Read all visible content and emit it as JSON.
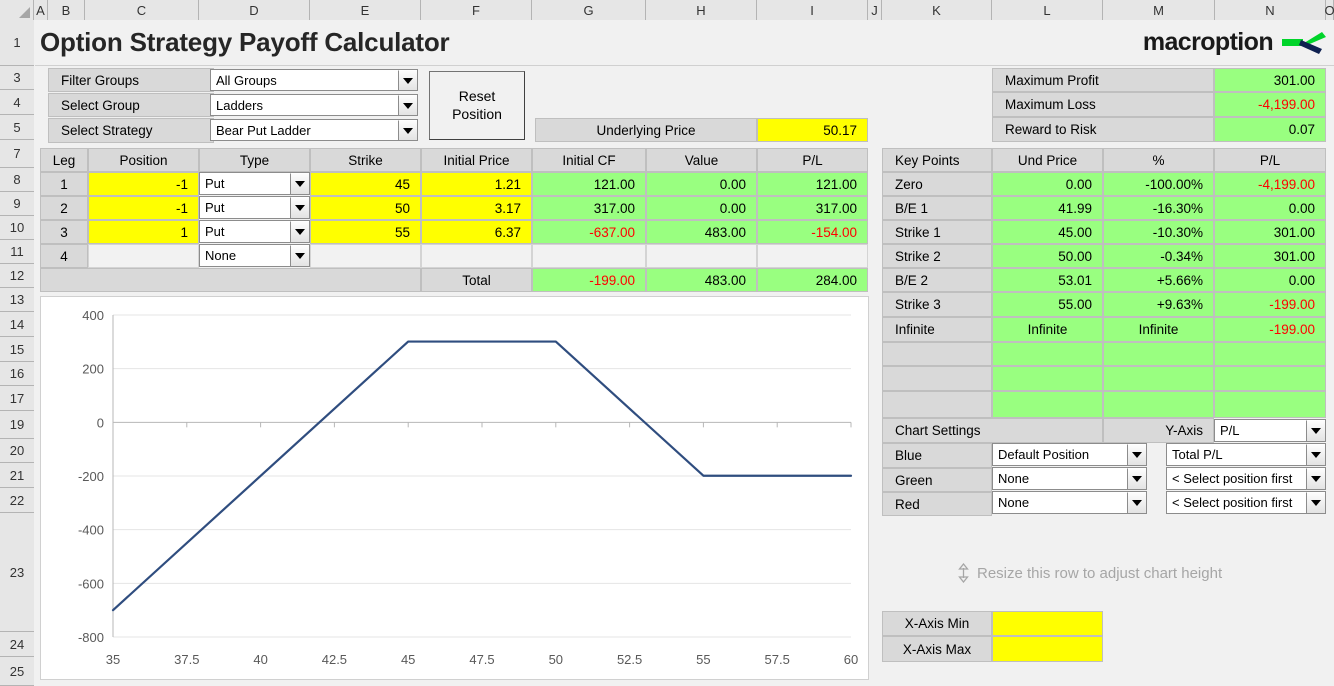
{
  "app": {
    "title": "Option Strategy Payoff Calculator",
    "logo_text": "macroption",
    "column_headers": [
      "A",
      "B",
      "C",
      "D",
      "E",
      "F",
      "G",
      "H",
      "I",
      "J",
      "K",
      "L",
      "M",
      "N",
      "O"
    ],
    "row_headers": [
      "1",
      "3",
      "4",
      "5",
      "7",
      "8",
      "9",
      "10",
      "11",
      "12",
      "13",
      "14",
      "15",
      "16",
      "17",
      "19",
      "20",
      "21",
      "22",
      "23",
      "24",
      "25"
    ]
  },
  "selectors": {
    "filter_groups_label": "Filter Groups",
    "filter_groups_value": "All Groups",
    "select_group_label": "Select Group",
    "select_group_value": "Ladders",
    "select_strategy_label": "Select Strategy",
    "select_strategy_value": "Bear Put Ladder"
  },
  "reset_button": {
    "line1": "Reset",
    "line2": "Position"
  },
  "underlying": {
    "label": "Underlying Price",
    "value": "50.17"
  },
  "summary": {
    "rows": [
      {
        "label": "Maximum Profit",
        "value": "301.00",
        "negative": false
      },
      {
        "label": "Maximum Loss",
        "value": "-4,199.00",
        "negative": true
      },
      {
        "label": "Reward to Risk",
        "value": "0.07",
        "negative": false
      }
    ]
  },
  "legs_table": {
    "headers": [
      "Leg",
      "Position",
      "Type",
      "Strike",
      "Initial Price",
      "Initial CF",
      "Value",
      "P/L"
    ],
    "rows": [
      {
        "leg": "1",
        "position": "-1",
        "type": "Put",
        "strike": "45",
        "initial_price": "1.21",
        "initial_cf": "121.00",
        "cf_negative": false,
        "value": "0.00",
        "pl": "121.00",
        "pl_negative": false,
        "active": true
      },
      {
        "leg": "2",
        "position": "-1",
        "type": "Put",
        "strike": "50",
        "initial_price": "3.17",
        "initial_cf": "317.00",
        "cf_negative": false,
        "value": "0.00",
        "pl": "317.00",
        "pl_negative": false,
        "active": true
      },
      {
        "leg": "3",
        "position": "1",
        "type": "Put",
        "strike": "55",
        "initial_price": "6.37",
        "initial_cf": "-637.00",
        "cf_negative": true,
        "value": "483.00",
        "pl": "-154.00",
        "pl_negative": true,
        "active": true
      },
      {
        "leg": "4",
        "position": "",
        "type": "None",
        "strike": "",
        "initial_price": "",
        "initial_cf": "",
        "cf_negative": false,
        "value": "",
        "pl": "",
        "pl_negative": false,
        "active": false
      }
    ],
    "total": {
      "label": "Total",
      "initial_cf": "-199.00",
      "cf_negative": true,
      "value": "483.00",
      "pl": "284.00",
      "pl_negative": false
    }
  },
  "key_points": {
    "headers": [
      "Key Points",
      "Und Price",
      "%",
      "P/L"
    ],
    "rows": [
      {
        "name": "Zero",
        "und_price": "0.00",
        "pct": "-100.00%",
        "pl": "-4,199.00",
        "pl_negative": true
      },
      {
        "name": "B/E 1",
        "und_price": "41.99",
        "pct": "-16.30%",
        "pl": "0.00",
        "pl_negative": false
      },
      {
        "name": "Strike 1",
        "und_price": "45.00",
        "pct": "-10.30%",
        "pl": "301.00",
        "pl_negative": false
      },
      {
        "name": "Strike 2",
        "und_price": "50.00",
        "pct": "-0.34%",
        "pl": "301.00",
        "pl_negative": false
      },
      {
        "name": "B/E 2",
        "und_price": "53.01",
        "pct": "+5.66%",
        "pl": "0.00",
        "pl_negative": false
      },
      {
        "name": "Strike 3",
        "und_price": "55.00",
        "pct": "+9.63%",
        "pl": "-199.00",
        "pl_negative": true
      },
      {
        "name": "Infinite",
        "und_price": "Infinite",
        "pct": "Infinite",
        "pl": "-199.00",
        "pl_negative": true
      }
    ],
    "empty_rows": 3
  },
  "chart_settings": {
    "title": "Chart Settings",
    "y_axis_label": "Y-Axis",
    "y_axis_value": "P/L",
    "series": [
      {
        "color_label": "Blue",
        "position": "Default Position",
        "metric": "Total P/L"
      },
      {
        "color_label": "Green",
        "position": "None",
        "metric": "< Select position first"
      },
      {
        "color_label": "Red",
        "position": "None",
        "metric": "< Select position first"
      }
    ]
  },
  "resize_hint": "Resize this row to adjust chart height",
  "axis_controls": {
    "x_min_label": "X-Axis Min",
    "x_min_value": "",
    "x_max_label": "X-Axis Max",
    "x_max_value": ""
  },
  "chart_data": {
    "type": "line",
    "title": "",
    "xlabel": "",
    "ylabel": "",
    "xlim": [
      35,
      60
    ],
    "ylim": [
      -800,
      400
    ],
    "xticks": [
      35,
      37.5,
      40,
      42.5,
      45,
      47.5,
      50,
      52.5,
      55,
      57.5,
      60
    ],
    "yticks": [
      -800,
      -600,
      -400,
      -200,
      0,
      200,
      400
    ],
    "grid": true,
    "legend": "none",
    "series": [
      {
        "name": "Total P/L",
        "color": "#2f4d7f",
        "x": [
          35,
          45,
          50,
          55,
          60
        ],
        "y": [
          -700,
          301,
          301,
          -199,
          -199
        ]
      }
    ]
  },
  "colors": {
    "green_cell": "#99ff80",
    "yellow_cell": "#ffff00",
    "label_cell": "#d9d9d9",
    "negative_text": "#ff0000",
    "chart_line": "#2f4d7f",
    "logo_green": "#00d42a",
    "logo_navy": "#0e2050"
  }
}
